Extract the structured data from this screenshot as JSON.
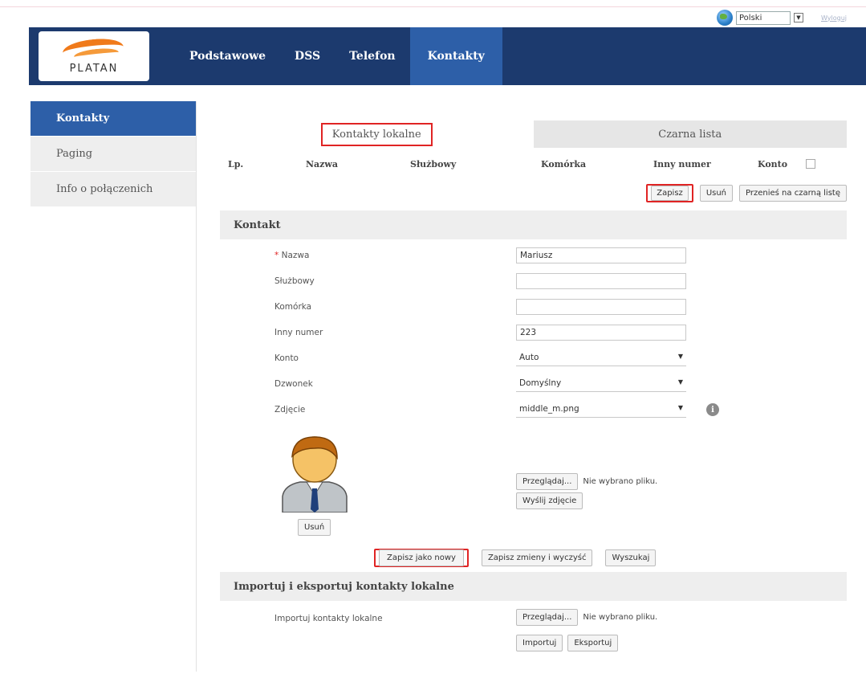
{
  "language": {
    "selected": "Polski",
    "logout": "Wyloguj"
  },
  "brand": "PLATAN",
  "nav": {
    "items": [
      "Podstawowe",
      "DSS",
      "Telefon",
      "Kontakty"
    ]
  },
  "sidebar": {
    "items": [
      "Kontakty",
      "Paging",
      "Info o połączenich"
    ]
  },
  "tabs": {
    "local": "Kontakty lokalne",
    "blacklist": "Czarna lista"
  },
  "table": {
    "columns": [
      "Lp.",
      "Nazwa",
      "Służbowy",
      "Komórka",
      "Inny numer",
      "Konto"
    ],
    "actions": {
      "save": "Zapisz",
      "delete": "Usuń",
      "move": "Przenieś na czarną listę"
    }
  },
  "contact": {
    "title": "Kontakt",
    "required_mark": "*",
    "fields": {
      "name": {
        "label": "Nazwa",
        "value": "Mariusz"
      },
      "work": {
        "label": "Służbowy",
        "value": ""
      },
      "mobile": {
        "label": "Komórka",
        "value": ""
      },
      "other": {
        "label": "Inny numer",
        "value": "223"
      },
      "account": {
        "label": "Konto",
        "value": "Auto"
      },
      "ring": {
        "label": "Dzwonek",
        "value": "Domyślny"
      },
      "photo": {
        "label": "Zdjęcie",
        "value": "middle_m.png"
      }
    },
    "browse_label": "Przeglądaj...",
    "no_file": "Nie wybrano pliku.",
    "send_photo": "Wyślij zdjęcie",
    "avatar_delete": "Usuń",
    "buttons": {
      "save_new": "Zapisz jako nowy",
      "save_clear": "Zapisz zmieny i wyczyść",
      "search": "Wyszukaj"
    }
  },
  "import": {
    "title": "Importuj i eksportuj kontakty lokalne",
    "label": "Importuj kontakty lokalne",
    "browse_label": "Przeglądaj...",
    "no_file": "Nie wybrano pliku.",
    "import_btn": "Importuj",
    "export_btn": "Eksportuj"
  },
  "colors": {
    "navbar": "#1c3a6e",
    "active": "#2d5fa8",
    "highlight": "#e02424",
    "logo_orange": "#f07a1a"
  }
}
